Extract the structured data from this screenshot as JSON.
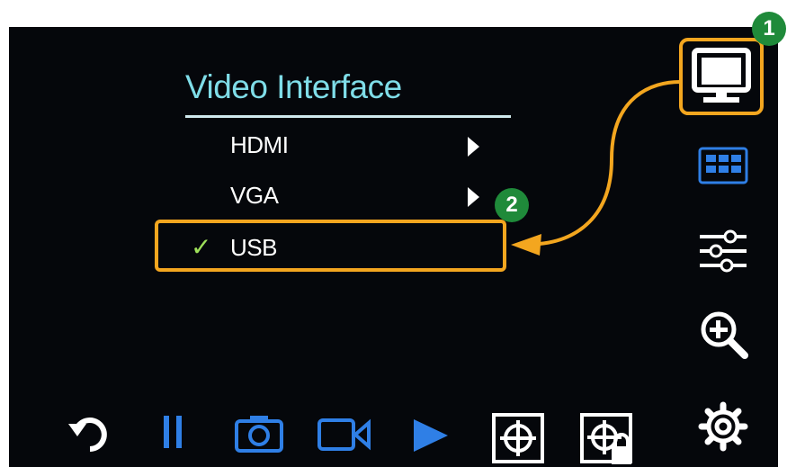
{
  "menu": {
    "title": "Video Interface",
    "items": [
      {
        "label": "HDMI",
        "has_submenu": true,
        "selected": false
      },
      {
        "label": "VGA",
        "has_submenu": true,
        "selected": false
      },
      {
        "label": "USB",
        "has_submenu": false,
        "selected": true
      }
    ]
  },
  "callouts": {
    "step1": "1",
    "step2": "2"
  },
  "sidebar": {
    "icons": [
      "monitor-icon",
      "grid-layout-icon",
      "sliders-icon",
      "zoom-in-icon",
      "settings-gear-icon"
    ]
  },
  "bottom_toolbar": {
    "icons": [
      "rotate-icon",
      "pause-icon",
      "camera-icon",
      "video-camera-icon",
      "play-icon",
      "crosshair-icon",
      "crosshair-lock-icon"
    ]
  },
  "colors": {
    "title": "#7fdde8",
    "highlight": "#f3a61f",
    "check": "#9ee05a",
    "accent_blue": "#2f7fe6",
    "badge": "#1f8a3a"
  }
}
